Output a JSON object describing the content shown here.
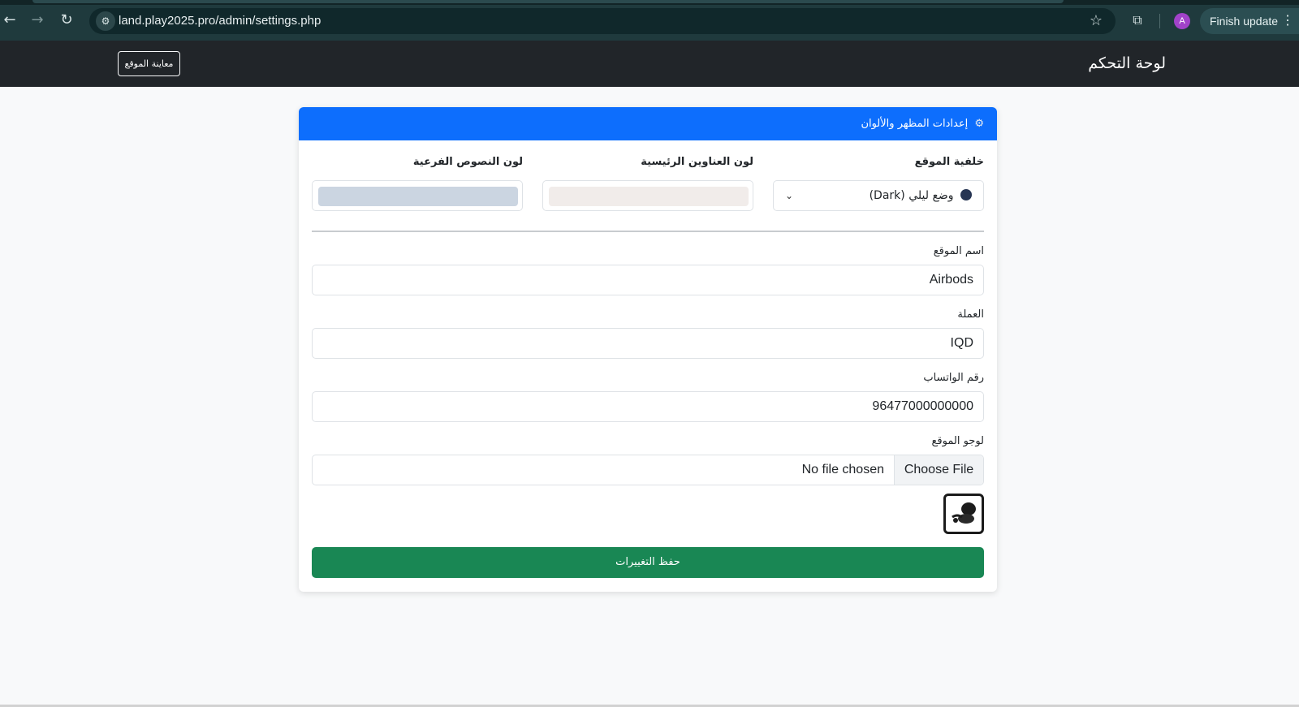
{
  "browser": {
    "url": "land.play2025.pro/admin/settings.php",
    "avatar_letter": "A",
    "finish_update": "Finish update"
  },
  "navbar": {
    "brand": "لوحة التحكم",
    "preview_button": "معاينة الموقع"
  },
  "card": {
    "header": "إعدادات المظهر والألوان",
    "background": {
      "label": "خلفية الموقع",
      "selected": "وضع ليلي (Dark)"
    },
    "heading_color": {
      "label": "لون العناوين الرئيسية",
      "value": "#f1ecea"
    },
    "subtext_color": {
      "label": "لون النصوص الفرعية",
      "value": "#cbd5e1"
    },
    "site_name": {
      "label": "اسم الموقع",
      "value": "Airbods"
    },
    "currency": {
      "label": "العملة",
      "value": "IQD"
    },
    "whatsapp": {
      "label": "رقم الواتساب",
      "value": "96477000000000"
    },
    "logo": {
      "label": "لوجو الموقع",
      "choose_file": "Choose File",
      "file_status": "No file chosen"
    },
    "save_button": "حفظ التغييرات"
  },
  "colors": {
    "navbar": "#212529",
    "header": "#0d6efd",
    "save": "#198754"
  }
}
